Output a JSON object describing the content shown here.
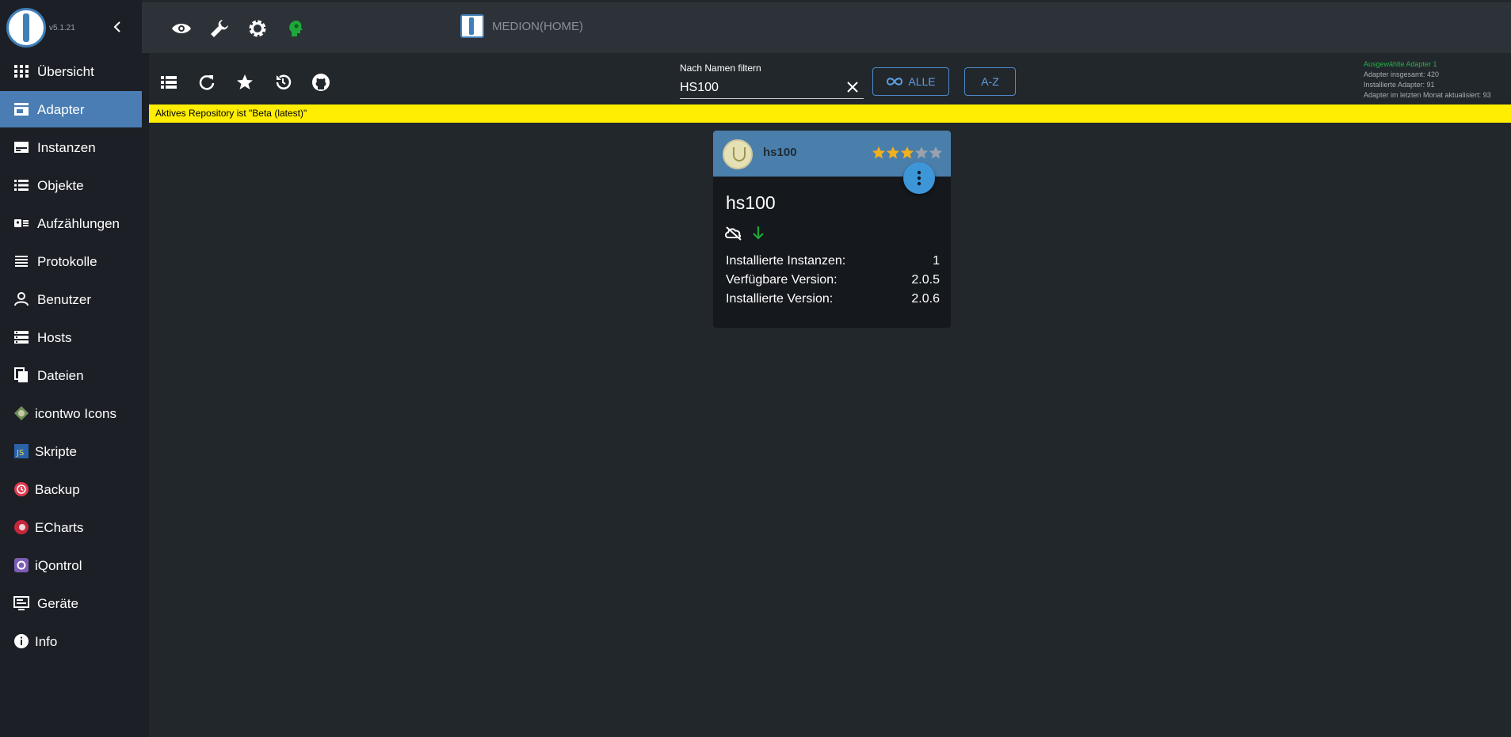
{
  "app": {
    "version": "v5.1.21",
    "host": "MEDION(HOME)"
  },
  "sidebar": {
    "items": [
      {
        "label": "Übersicht",
        "icon": "apps-grid-icon"
      },
      {
        "label": "Adapter",
        "icon": "store-icon",
        "active": true
      },
      {
        "label": "Instanzen",
        "icon": "instances-icon"
      },
      {
        "label": "Objekte",
        "icon": "list-icon"
      },
      {
        "label": "Aufzählungen",
        "icon": "enum-icon"
      },
      {
        "label": "Protokolle",
        "icon": "logs-icon"
      },
      {
        "label": "Benutzer",
        "icon": "user-icon"
      },
      {
        "label": "Hosts",
        "icon": "hosts-icon"
      },
      {
        "label": "Dateien",
        "icon": "files-icon"
      },
      {
        "label": "icontwo Icons",
        "icon": "icontwo-icon"
      },
      {
        "label": "Skripte",
        "icon": "javascript-icon"
      },
      {
        "label": "Backup",
        "icon": "backup-icon"
      },
      {
        "label": "ECharts",
        "icon": "echarts-icon"
      },
      {
        "label": "iQontrol",
        "icon": "iqontrol-icon"
      },
      {
        "label": "Geräte",
        "icon": "devices-icon"
      },
      {
        "label": "Info",
        "icon": "info-icon"
      }
    ]
  },
  "toolbar": {
    "filter_label": "Nach Namen filtern",
    "filter_value": "HS100",
    "all_label": "ALLE",
    "sort_label": "A-Z"
  },
  "stats": {
    "selected": "Ausgewählte Adapter 1",
    "total": "Adapter insgesamt: 420",
    "installed": "Installierte Adapter: 91",
    "updated": "Adapter im letzten Monat aktualisiert: 93"
  },
  "banner": {
    "text": "Aktives Repository ist \"Beta (latest)\""
  },
  "card": {
    "header_name": "hs100",
    "title": "hs100",
    "rating": 3.5,
    "rows": [
      {
        "label": "Installierte Instanzen:",
        "value": "1"
      },
      {
        "label": "Verfügbare Version:",
        "value": "2.0.5"
      },
      {
        "label": "Installierte Version:",
        "value": "2.0.6"
      }
    ]
  },
  "colors": {
    "sidebar_bg": "#1c2026",
    "active_item": "#4a7db3",
    "banner": "#ffee00",
    "accent": "#5da0e6",
    "card_header": "#4b7fab",
    "star": "#f2b01e"
  }
}
